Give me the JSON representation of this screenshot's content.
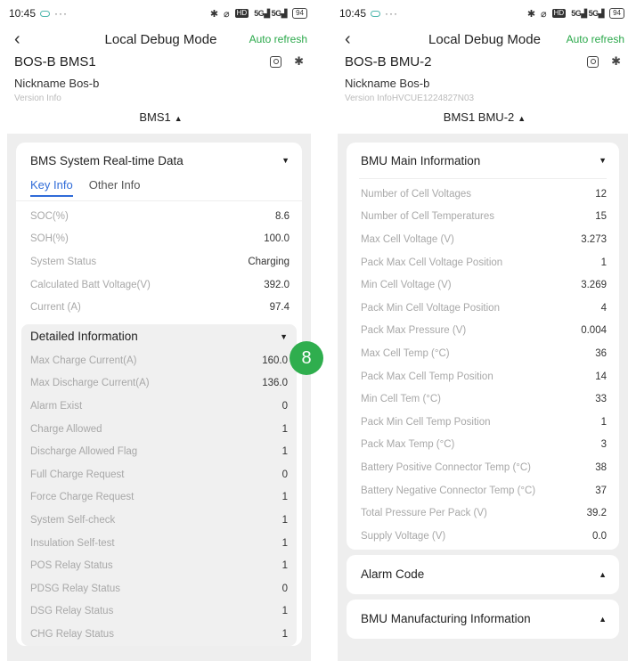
{
  "left": {
    "status": {
      "time": "10:45",
      "dots": "···",
      "signal1": "5G",
      "signal2": "5G",
      "battery": "94"
    },
    "header": {
      "title": "Local Debug Mode",
      "auto_refresh": "Auto refresh",
      "device_name": "BOS-B BMS1",
      "nickname": "Nickname  Bos-b",
      "version": "Version Info",
      "selector": "BMS1"
    },
    "card": {
      "title": "BMS System Real-time Data",
      "tabs": [
        "Key Info",
        "Other Info"
      ],
      "rows": [
        {
          "label": "SOC(%)",
          "value": "8.6"
        },
        {
          "label": "SOH(%)",
          "value": "100.0"
        },
        {
          "label": "System Status",
          "value": "Charging"
        },
        {
          "label": "Calculated Batt Voltage(V)",
          "value": "392.0"
        },
        {
          "label": "Current (A)",
          "value": "97.4"
        }
      ]
    },
    "detail": {
      "title": "Detailed Information",
      "rows": [
        {
          "label": "Max Charge Current(A)",
          "value": "160.0"
        },
        {
          "label": "Max Discharge Current(A)",
          "value": "136.0"
        },
        {
          "label": "Alarm Exist",
          "value": "0"
        },
        {
          "label": "Charge Allowed",
          "value": "1"
        },
        {
          "label": "Discharge Allowed Flag",
          "value": "1"
        },
        {
          "label": "Full Charge Request",
          "value": "0"
        },
        {
          "label": "Force Charge Request",
          "value": "1"
        },
        {
          "label": "System Self-check",
          "value": "1"
        },
        {
          "label": "Insulation Self-test",
          "value": "1"
        },
        {
          "label": "POS Relay Status",
          "value": "1"
        },
        {
          "label": "PDSG Relay Status",
          "value": "0"
        },
        {
          "label": "DSG Relay Status",
          "value": "1"
        },
        {
          "label": "CHG Relay Status",
          "value": "1"
        }
      ]
    }
  },
  "badge": "8",
  "right": {
    "status": {
      "time": "10:45",
      "dots": "···",
      "signal1": "5G",
      "signal2": "5G",
      "battery": "94"
    },
    "header": {
      "title": "Local Debug Mode",
      "auto_refresh": "Auto refresh",
      "device_name": "BOS-B BMU-2",
      "nickname": "Nickname  Bos-b",
      "version": "Version InfoHVCUE1224827N03",
      "selector": "BMS1 BMU-2"
    },
    "main_card": {
      "title": "BMU Main Information",
      "rows": [
        {
          "label": "Number of Cell Voltages",
          "value": "12"
        },
        {
          "label": "Number of Cell Temperatures",
          "value": "15"
        },
        {
          "label": "Max Cell Voltage (V)",
          "value": "3.273"
        },
        {
          "label": "Pack Max Cell Voltage Position",
          "value": "1"
        },
        {
          "label": "Min Cell Voltage (V)",
          "value": "3.269"
        },
        {
          "label": "Pack Min Cell Voltage Position",
          "value": "4"
        },
        {
          "label": "Pack Max Pressure (V)",
          "value": "0.004"
        },
        {
          "label": "Max Cell Temp (°C)",
          "value": "36"
        },
        {
          "label": "Pack Max Cell Temp Position",
          "value": "14"
        },
        {
          "label": "Min Cell Tem (°C)",
          "value": "33"
        },
        {
          "label": "Pack Min Cell Temp Position",
          "value": "1"
        },
        {
          "label": "Pack Max Temp (°C)",
          "value": "3"
        },
        {
          "label": "Battery Positive Connector Temp (°C)",
          "value": "38"
        },
        {
          "label": "Battery Negative Connector Temp (°C)",
          "value": "37"
        },
        {
          "label": "Total Pressure Per Pack (V)",
          "value": "39.2"
        },
        {
          "label": "Supply Voltage (V)",
          "value": "0.0"
        }
      ]
    },
    "alarm_card": {
      "title": "Alarm Code"
    },
    "mfg_card": {
      "title": "BMU Manufacturing Information"
    }
  }
}
